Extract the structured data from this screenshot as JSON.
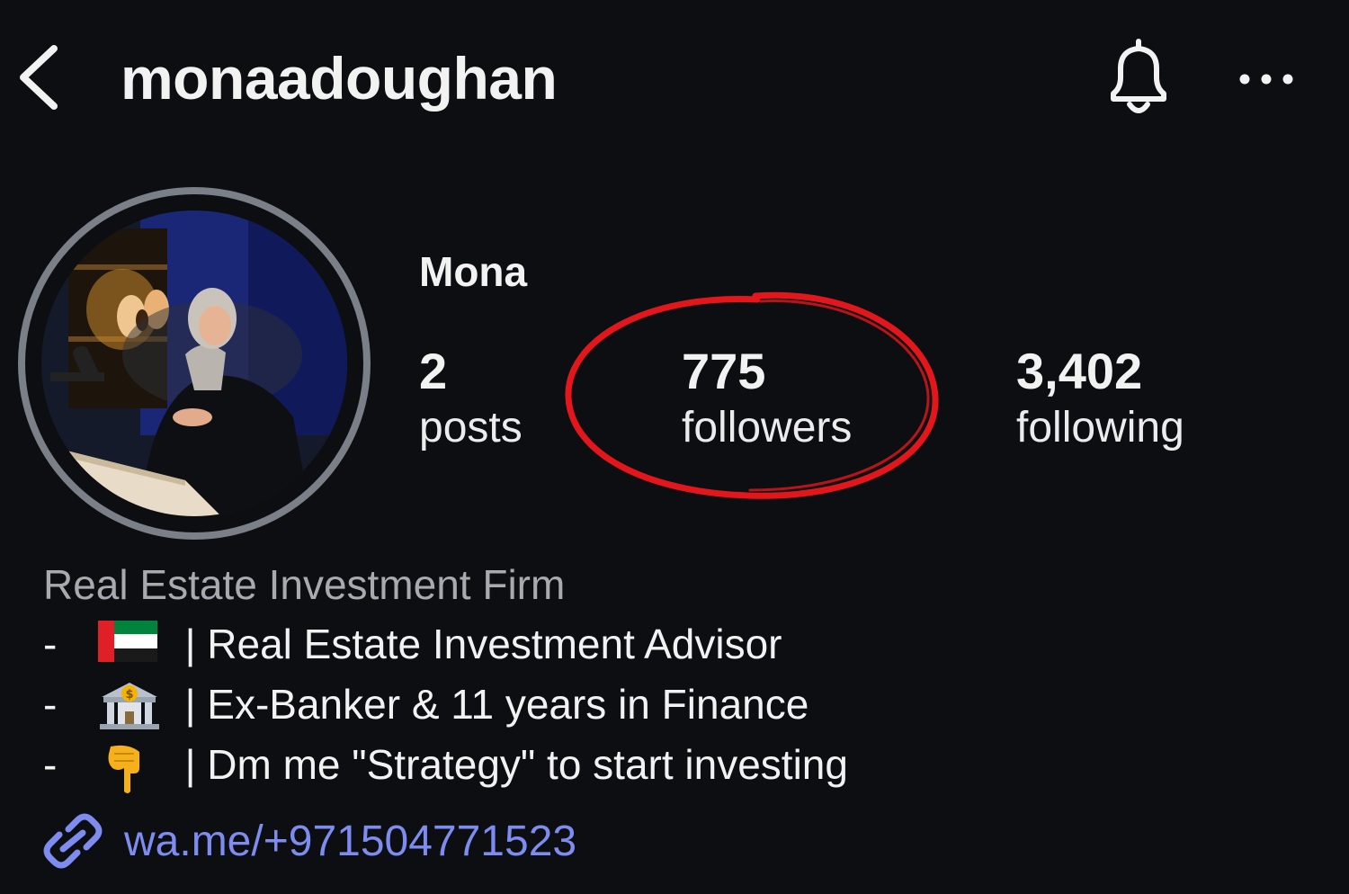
{
  "header": {
    "username": "monaadoughan",
    "icons": {
      "back": "chevron-left-icon",
      "notifications": "bell-icon",
      "more": "more-horizontal-icon"
    }
  },
  "profile": {
    "display_name": "Mona",
    "stats": {
      "posts": {
        "value": "2",
        "label": "posts"
      },
      "followers": {
        "value": "775",
        "label": "followers"
      },
      "following": {
        "value": "3,402",
        "label": "following"
      }
    },
    "highlight_annotation": {
      "target": "followers",
      "color": "#e3161b"
    }
  },
  "bio": {
    "category": "Real Estate Investment Firm",
    "lines": [
      {
        "prefix": "-",
        "emoji": "uae-flag",
        "text": "| Real Estate Investment Advisor"
      },
      {
        "prefix": "-",
        "emoji": "bank-building",
        "text": "| Ex-Banker & 11 years in Finance"
      },
      {
        "prefix": "-",
        "emoji": "pointing-down-hand",
        "text": "| Dm me \"Strategy\" to start investing"
      }
    ]
  },
  "link": {
    "text": "wa.me/+971504771523",
    "icon": "link-icon"
  },
  "colors": {
    "background": "#0c0e12",
    "link": "#7e8cf0",
    "annotation": "#e3161b",
    "avatar_ring": "#7b7f87"
  }
}
